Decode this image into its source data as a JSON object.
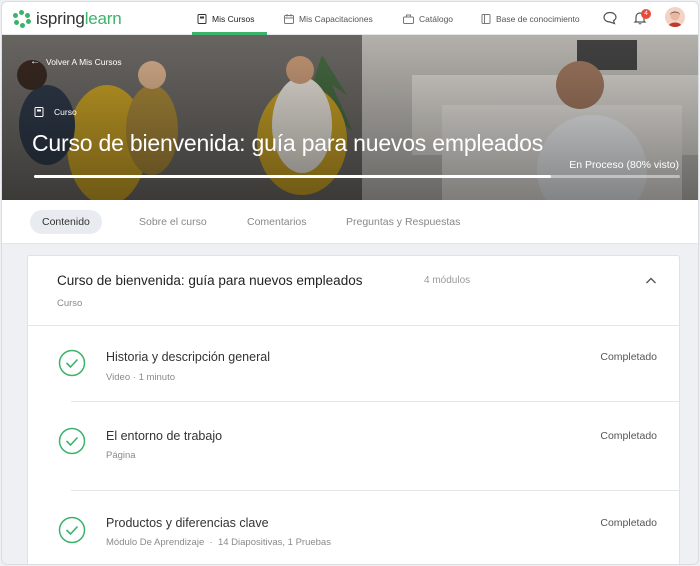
{
  "app": {
    "logo_prefix": "ispring",
    "logo_suffix": "learn",
    "brand_color": "#3bb36b"
  },
  "nav": {
    "items": [
      {
        "label": "Mis Cursos",
        "icon": "book-icon",
        "active": true
      },
      {
        "label": "Mis Capacitaciones",
        "icon": "calendar-icon",
        "active": false
      },
      {
        "label": "Catálogo",
        "icon": "catalog-icon",
        "active": false
      },
      {
        "label": "Base de conocimiento",
        "icon": "knowledge-base-icon",
        "active": false
      }
    ],
    "notifications_count": "4"
  },
  "hero": {
    "back_label": "Volver A Mis Cursos",
    "type_label": "Curso",
    "title": "Curso de bienvenida: guía para nuevos empleados",
    "status": "En Proceso (80% visto)",
    "progress": 0.8
  },
  "tabs": [
    "Contenido",
    "Sobre el curso",
    "Comentarios",
    "Preguntas y Respuestas"
  ],
  "course_card": {
    "title": "Curso de bienvenida: guía para nuevos empleados",
    "subtitle": "Curso",
    "modules": "4 módulos",
    "items": [
      {
        "title": "Historia y descripción general",
        "meta": "Video  ·  1 minuto",
        "status": "Completado"
      },
      {
        "title": "El entorno de trabajo",
        "meta": "Página",
        "status": "Completado"
      },
      {
        "title": "Productos y diferencias clave",
        "meta": "Módulo De Aprendizaje  ·  14 Diapositivas, 1 Pruebas",
        "status": "Completado"
      }
    ]
  }
}
